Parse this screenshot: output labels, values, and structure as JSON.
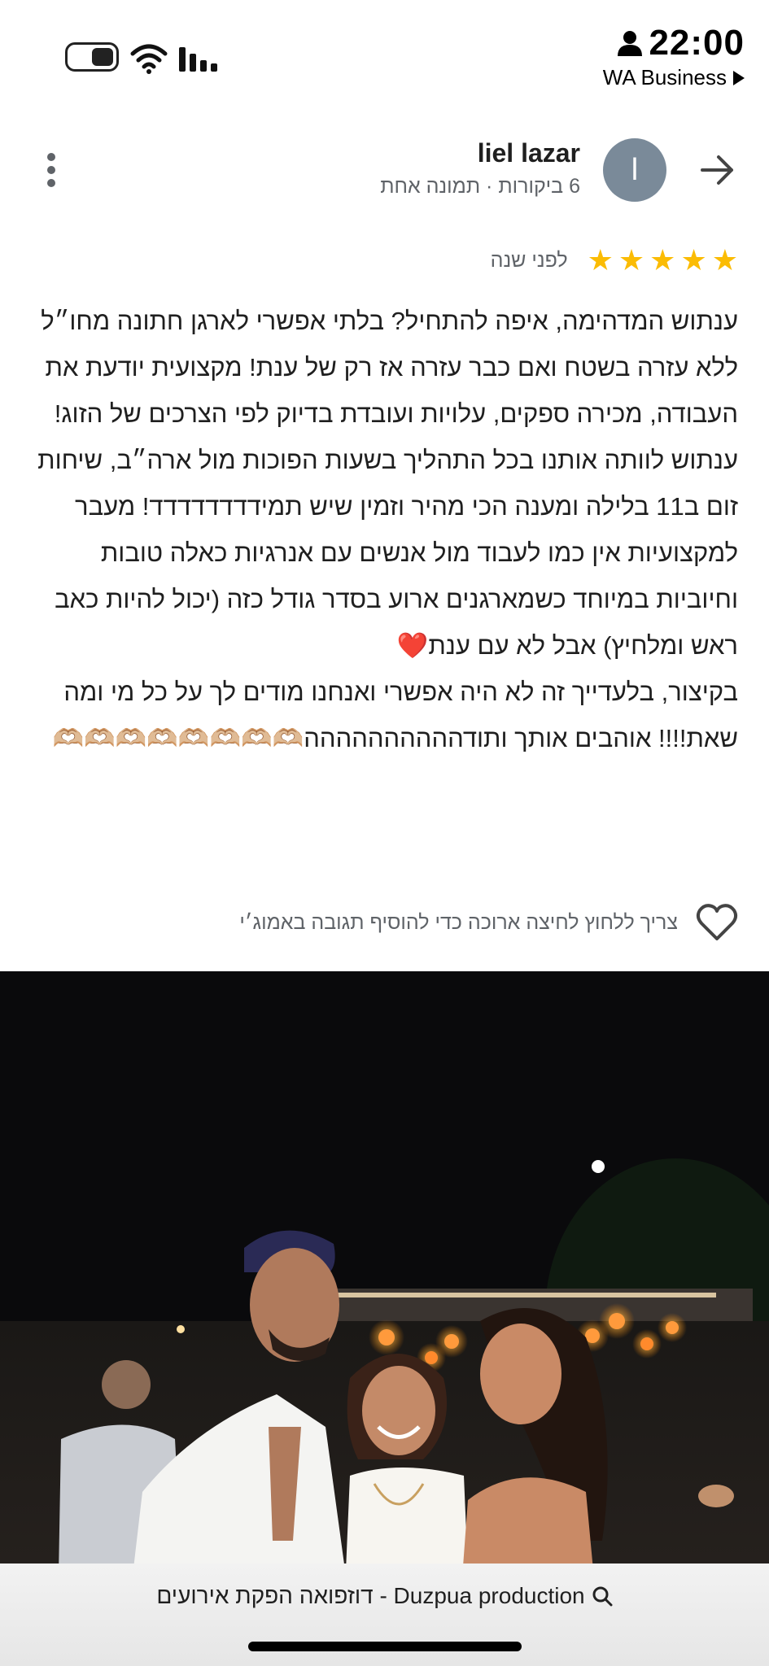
{
  "status_bar": {
    "time": "22:00",
    "back_app": "WA Business"
  },
  "header": {
    "reviewer_name": "liel lazar",
    "reviewer_meta": "6 ביקורות · תמונה אחת",
    "avatar_letter": "l"
  },
  "review": {
    "stars": 5,
    "time_ago": "לפני שנה",
    "paragraph1": "ענתוש המדהימה, איפה להתחיל? בלתי אפשרי לארגן חתונה מחו״ל ללא עזרה בשטח ואם כבר עזרה אז רק של ענת! מקצועית יודעת את העבודה, מכירה ספקים, עלויות ועובדת בדיוק לפי הצרכים של הזוג! ענתוש לוותה אותנו בכל התהליך בשעות הפוכות מול ארה״ב, שיחות זום ב11 בלילה ומענה הכי מהיר וזמין שיש תמידדדדדדדד! מעבר למקצועיות אין כמו לעבוד מול אנשים עם אנרגיות כאלה טובות וחיוביות במיוחד כשמארגנים ארוע בסדר גודל כזה (יכול להיות כאב ראש ומלחיץ) אבל לא עם ענת❤️",
    "paragraph2": "בקיצור, בלעדייך זה לא היה אפשרי ואנחנו מודים לך על כל מי ומה שאת!!!! אוהבים אותך ותודהההההההההה🫶🏼🫶🏼🫶🏼🫶🏼🫶🏼🫶🏼🫶🏼🫶🏼",
    "like_hint": "צריך ללחוץ לחיצה ארוכה כדי להוסיף תגובה באמוג׳י"
  },
  "bottom_bar": {
    "search_title": "דוזפואה הפקת אירועים - Duzpua production"
  },
  "colors": {
    "star": "#fbbc04",
    "avatar_bg": "#7a8a99",
    "secondary_text": "#5f6368"
  }
}
